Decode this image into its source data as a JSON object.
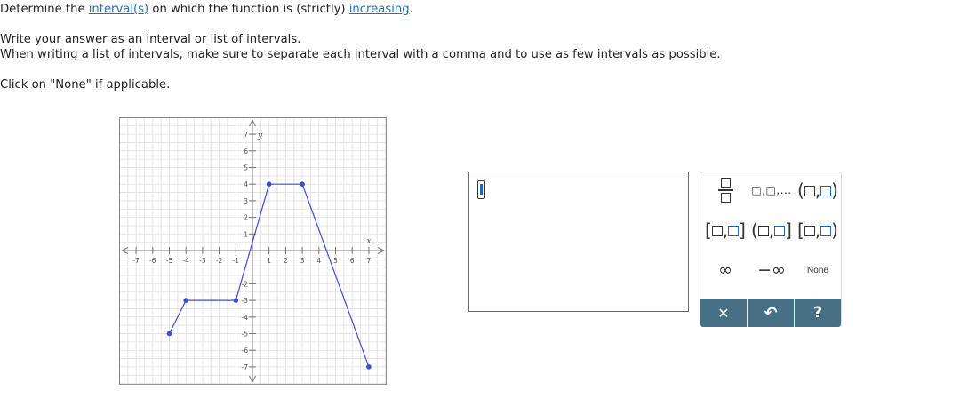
{
  "prompt": {
    "line1_pre": "Determine the ",
    "line1_link1": "interval(s)",
    "line1_mid": " on which the function is (strictly) ",
    "line1_link2": "increasing",
    "line1_post": ".",
    "line2": "Write your answer as an interval or list of intervals.",
    "line3": "When writing a list of intervals, make sure to separate each interval with a comma and to use as few intervals as possible.",
    "line4": "Click on \"None\" if applicable."
  },
  "graph": {
    "x_axis_label": "x",
    "y_axis_label": "y",
    "xlim": [
      -7,
      7
    ],
    "ylim": [
      -7,
      7
    ],
    "x_ticks": [
      "-7",
      "-6",
      "-5",
      "-4",
      "-3",
      "-2",
      "-1",
      "1",
      "2",
      "3",
      "4",
      "5",
      "6",
      "7"
    ],
    "y_ticks": [
      "7",
      "6",
      "5",
      "4",
      "3",
      "2",
      "1",
      "-2",
      "-3",
      "-4",
      "-5",
      "-6",
      "-7"
    ],
    "line_color": "#3b4fd6",
    "points": [
      [
        -5,
        -5
      ],
      [
        -4,
        -3
      ],
      [
        -1,
        -3
      ],
      [
        1,
        4
      ],
      [
        3,
        4
      ],
      [
        7,
        -7
      ]
    ]
  },
  "answer": {
    "value": ""
  },
  "palette": {
    "list_glyph": "□,□,...",
    "inf_label": "∞",
    "neg_inf_label": "−∞",
    "none_label": "None",
    "clear_label": "✕",
    "undo_label": "↶",
    "help_label": "?"
  },
  "colors": {
    "link": "#2a6fb5",
    "toolbar": "#467085",
    "accent_blue": "#1a66c9"
  }
}
